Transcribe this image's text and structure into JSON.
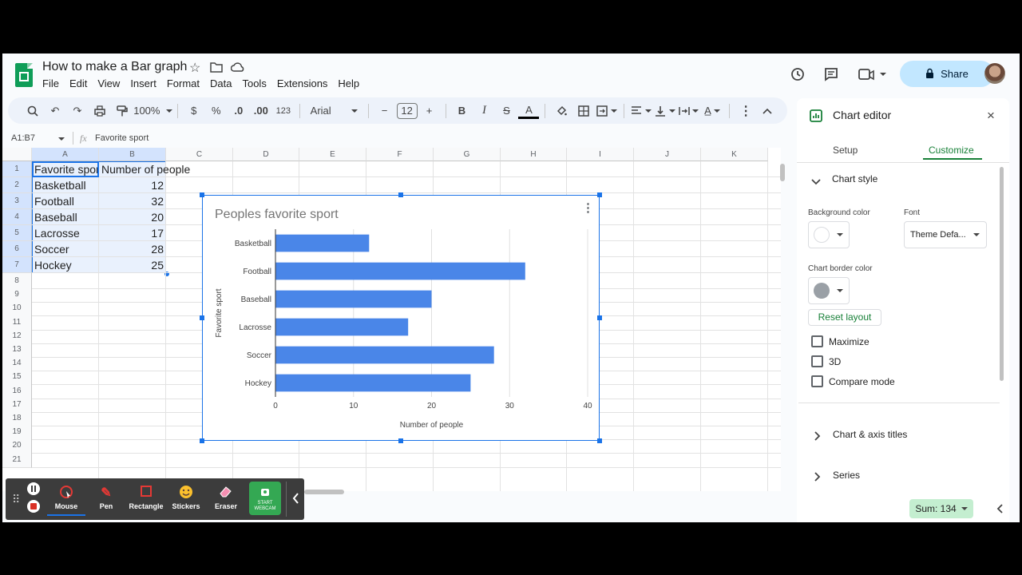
{
  "doc": {
    "title": "How to make a Bar graph"
  },
  "menu": [
    "File",
    "Edit",
    "View",
    "Insert",
    "Format",
    "Data",
    "Tools",
    "Extensions",
    "Help"
  ],
  "header": {
    "share_label": "Share"
  },
  "toolbar": {
    "zoom": "100%",
    "currency": "$",
    "percent": "%",
    "dec_decrease": ".0",
    "dec_increase": ".00",
    "format_123": "123",
    "font": "Arial",
    "font_size": "12",
    "minus": "−",
    "plus": "+"
  },
  "formula_bar": {
    "name_box": "A1:B7",
    "fx": "fx",
    "value": "Favorite sport"
  },
  "sheet": {
    "columns": [
      "A",
      "B",
      "C",
      "D",
      "E",
      "F",
      "G",
      "H",
      "I",
      "J",
      "K"
    ],
    "rows": [
      "1",
      "2",
      "3",
      "4",
      "5",
      "6",
      "7",
      "8",
      "9",
      "10",
      "11",
      "12",
      "13",
      "14",
      "15",
      "16",
      "17",
      "18",
      "19",
      "20",
      "21"
    ],
    "data": [
      [
        "Favorite sport",
        "Number of people"
      ],
      [
        "Basketball",
        "12"
      ],
      [
        "Football",
        "32"
      ],
      [
        "Baseball",
        "20"
      ],
      [
        "Lacrosse",
        "17"
      ],
      [
        "Soccer",
        "28"
      ],
      [
        "Hockey",
        "25"
      ]
    ]
  },
  "chart_data": {
    "type": "bar",
    "orientation": "horizontal",
    "title": "Peoples favorite sport",
    "categories": [
      "Basketball",
      "Football",
      "Baseball",
      "Lacrosse",
      "Soccer",
      "Hockey"
    ],
    "values": [
      12,
      32,
      20,
      17,
      28,
      25
    ],
    "xlabel": "Number of people",
    "ylabel": "Favorite sport",
    "xlim": [
      0,
      40
    ],
    "xticks": [
      "0",
      "10",
      "20",
      "30",
      "40"
    ],
    "grid": true,
    "color": "#4a86e8"
  },
  "editor": {
    "title": "Chart editor",
    "tabs": [
      "Setup",
      "Customize"
    ],
    "section_chart_style": "Chart style",
    "bg_color_label": "Background color",
    "font_label": "Font",
    "font_value": "Theme Defa...",
    "border_color_label": "Chart border color",
    "reset_label": "Reset layout",
    "checkboxes": [
      "Maximize",
      "3D",
      "Compare mode"
    ],
    "section_titles": "Chart & axis titles",
    "section_series": "Series"
  },
  "annotate": {
    "tools": [
      "Mouse",
      "Pen",
      "Rectangle",
      "Stickers",
      "Eraser"
    ],
    "webcam": "START WEBCAM"
  },
  "status": {
    "sum": "Sum: 134"
  },
  "colors": {
    "accent": "#1a73e8",
    "sheets_green": "#0f9d58",
    "share_bg": "#c2e7ff",
    "customize_green": "#188038"
  }
}
